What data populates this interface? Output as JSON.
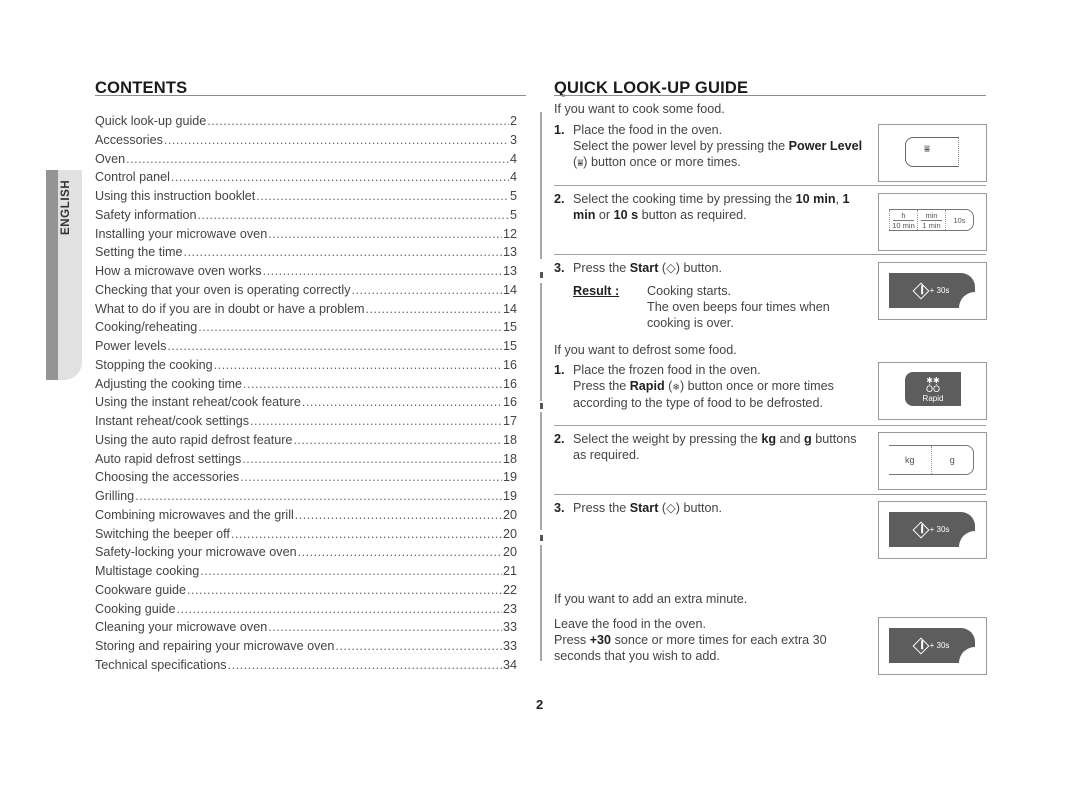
{
  "contents": {
    "title": "CONTENTS",
    "language_tab": "ENGLISH",
    "entries": [
      {
        "title": "Quick look-up guide",
        "page": "2"
      },
      {
        "title": "Accessories",
        "page": "3"
      },
      {
        "title": "Oven",
        "page": "4"
      },
      {
        "title": "Control panel",
        "page": "4"
      },
      {
        "title": "Using this instruction booklet",
        "page": "5"
      },
      {
        "title": "Safety information",
        "page": "5"
      },
      {
        "title": "Installing your microwave oven",
        "page": "12"
      },
      {
        "title": "Setting the time",
        "page": "13"
      },
      {
        "title": "How a microwave oven works",
        "page": "13"
      },
      {
        "title": "Checking that your oven is operating correctly",
        "page": "14"
      },
      {
        "title": "What to do if you are in doubt or have a problem",
        "page": "14"
      },
      {
        "title": "Cooking/reheating",
        "page": "15"
      },
      {
        "title": "Power levels",
        "page": "15"
      },
      {
        "title": "Stopping the cooking",
        "page": "16"
      },
      {
        "title": "Adjusting the cooking time",
        "page": "16"
      },
      {
        "title": "Using the instant reheat/cook feature",
        "page": "16"
      },
      {
        "title": "Instant reheat/cook settings",
        "page": "17"
      },
      {
        "title": "Using the auto rapid defrost feature",
        "page": "18"
      },
      {
        "title": "Auto rapid defrost settings",
        "page": "18"
      },
      {
        "title": "Choosing the accessories",
        "page": "19"
      },
      {
        "title": "Grilling",
        "page": "19"
      },
      {
        "title": "Combining microwaves and the grill",
        "page": "20"
      },
      {
        "title": "Switching the beeper off",
        "page": "20"
      },
      {
        "title": "Safety-locking your microwave oven",
        "page": "20"
      },
      {
        "title": "Multistage cooking",
        "page": "21"
      },
      {
        "title": "Cookware guide",
        "page": "22"
      },
      {
        "title": "Cooking guide",
        "page": "23"
      },
      {
        "title": "Cleaning your microwave oven",
        "page": "33"
      },
      {
        "title": "Storing and repairing your microwave oven",
        "page": "33"
      },
      {
        "title": "Technical specifications",
        "page": "34"
      }
    ]
  },
  "guide": {
    "title": "QUICK LOOK-UP GUIDE",
    "cook": {
      "intro": "If you want to cook some food.",
      "step1": {
        "num": "1.",
        "line1": "Place the food in the oven.",
        "line2a": "Select the power level by pressing the ",
        "line2b": "Power Level",
        "line3a": "(",
        "line3icon": "⩸",
        "line3b": ") button once or more times."
      },
      "step2": {
        "num": "2.",
        "a": "Select the cooking time by pressing the ",
        "b": "10 min",
        "c": ", ",
        "d": "1",
        "e": "min",
        "f": " or ",
        "g": "10 s",
        "h": " button as required."
      },
      "step3": {
        "num": "3.",
        "a": "Press the ",
        "b": "Start",
        "c": " (",
        "d": ") button.",
        "result_label": "Result :",
        "result_1": "Cooking starts.",
        "result_2": "The oven beeps four times when",
        "result_3": "cooking is over."
      }
    },
    "defrost": {
      "intro": "If you want to defrost some food.",
      "step1": {
        "num": "1.",
        "line1": "Place the frozen food in the oven.",
        "a": "Press the ",
        "b": "Rapid",
        "c": " (",
        "icon": "❄",
        "d": ") button once or more times",
        "line3": "according to the type of food to be defrosted."
      },
      "step2": {
        "num": "2.",
        "a": "Select the weight by pressing the ",
        "b": "kg",
        "c": " and ",
        "d": "g",
        "e": " buttons",
        "line2": "as required."
      },
      "step3": {
        "num": "3.",
        "a": "Press the ",
        "b": "Start",
        "c": " (",
        "d": ") button."
      }
    },
    "extra": {
      "intro": "If you want to add an extra minute.",
      "line1": "Leave the food in the oven.",
      "a": "Press ",
      "b": "+30",
      "c": " sonce or more times for each extra 30",
      "line3": "seconds that you wish to add."
    },
    "buttons": {
      "time": [
        {
          "top": "h",
          "bottom": "10 min"
        },
        {
          "top": "min",
          "bottom": "1 min"
        },
        {
          "single": "10s"
        }
      ],
      "start_label": "+ 30s",
      "rapid_icon": "✱✱",
      "rapid_drops": "ÓÓ",
      "rapid_label": "Rapid",
      "kg": "kg",
      "g": "g"
    }
  },
  "page_number": "2"
}
